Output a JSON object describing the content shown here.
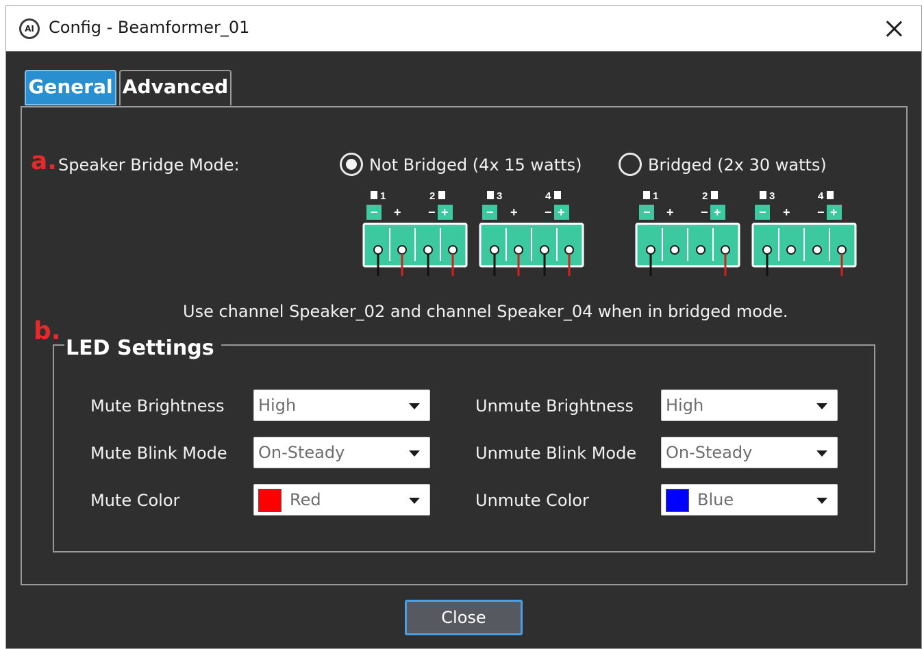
{
  "window": {
    "title": "Config - Beamformer_01",
    "app_icon": "AI"
  },
  "tabs": [
    {
      "label": "General",
      "active": true
    },
    {
      "label": "Advanced",
      "active": false
    }
  ],
  "bridge": {
    "marker": "a.",
    "label": "Speaker Bridge Mode:",
    "option_not_bridged": "Not Bridged (4x 15 watts)",
    "option_bridged": "Bridged (2x 30 watts)",
    "selected": "not_bridged",
    "note": "Use channel Speaker_02 and channel Speaker_04 when in bridged mode.",
    "channels": {
      "c1": "1",
      "c2": "2",
      "c3": "3",
      "c4": "4"
    },
    "terminal_colors": {
      "body": "#3cc9a0",
      "neg_wire": "#111111",
      "pos_wire": "#d62020"
    }
  },
  "led": {
    "marker": "b.",
    "title": "LED Settings",
    "mute_brightness": {
      "label": "Mute Brightness",
      "value": "High"
    },
    "mute_blink": {
      "label": "Mute Blink Mode",
      "value": "On-Steady"
    },
    "mute_color": {
      "label": "Mute Color",
      "value": "Red",
      "swatch": "#ff0000"
    },
    "unmute_brightness": {
      "label": "Unmute Brightness",
      "value": "High"
    },
    "unmute_blink": {
      "label": "Unmute Blink Mode",
      "value": "On-Steady"
    },
    "unmute_color": {
      "label": "Unmute Color",
      "value": "Blue",
      "swatch": "#0000ff"
    }
  },
  "footer": {
    "close_label": "Close"
  },
  "colors": {
    "accent": "#2a8fd0",
    "background": "#2f2f2f",
    "marker": "#e42b2b"
  }
}
